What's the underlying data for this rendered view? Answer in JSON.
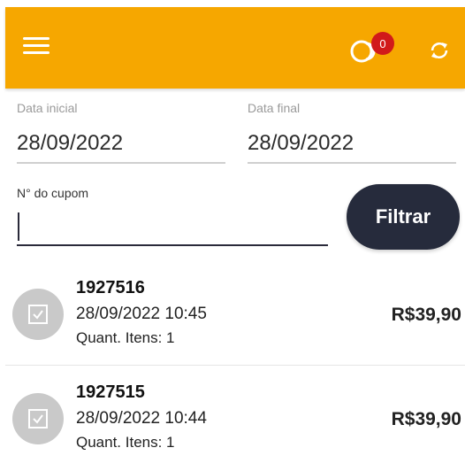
{
  "appbar": {
    "notifications_count": "0",
    "menu_icon": "hamburger-menu-icon",
    "notification_icon": "notification-bubble-icon",
    "sync_icon": "sync-icon",
    "background_color": "#f6a700"
  },
  "filters": {
    "start_date_label": "Data inicial",
    "start_date_value": "28/09/2022",
    "end_date_label": "Data final",
    "end_date_value": "28/09/2022",
    "coupon_label": "N° do cupom",
    "coupon_value": "",
    "filter_button_label": "Filtrar"
  },
  "coupons": [
    {
      "number": "1927516",
      "datetime": "28/09/2022 10:45",
      "items": "Quant. Itens: 1",
      "total": "R$39,90"
    },
    {
      "number": "1927515",
      "datetime": "28/09/2022 10:44",
      "items": "Quant. Itens: 1",
      "total": "R$39,90"
    }
  ]
}
